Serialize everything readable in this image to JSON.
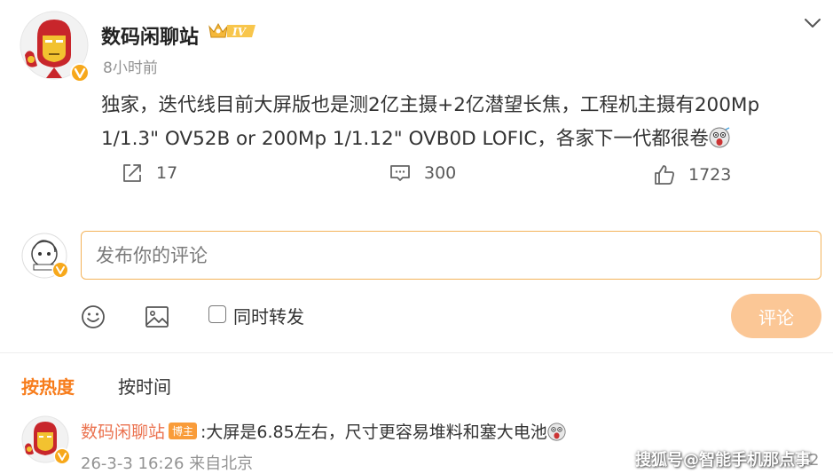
{
  "post": {
    "author_name": "数码闲聊站",
    "vip_level": "IV",
    "time": "8小时前",
    "text": "独家，迭代线目前大屏版也是测2亿主摄+2亿潜望长焦，工程机主摄有200Mp 1/1.3\" OV52B or 200Mp 1/1.12\" OVB0D LOFIC，各家下一代都很卷",
    "repost_count": "17",
    "comment_count": "300",
    "like_count": "1723"
  },
  "composer": {
    "placeholder": "发布你的评论",
    "repost_label": "同时转发",
    "submit_label": "评论"
  },
  "sort": {
    "hot_label": "按热度",
    "time_label": "按时间"
  },
  "comment": {
    "author_name": "数码闲聊站",
    "badge": "博主",
    "text": ":大屏是6.85左右，尺寸更容易堆料和塞大电池",
    "meta": "26-3-3 16:26 来自北京",
    "like_count": "2"
  },
  "watermark": "搜狐号@智能手机那点事",
  "colors": {
    "accent_orange": "#f77c1b",
    "input_border": "#f4b35a",
    "submit_bg": "#fbc796",
    "muted_text": "#939393",
    "author_link": "#eb7350"
  },
  "icons": [
    "chevron-down-icon",
    "repost-icon",
    "comment-icon",
    "like-icon",
    "emoji-icon",
    "image-icon",
    "checkbox-icon",
    "verified-badge-icon",
    "vip-crown-icon"
  ]
}
